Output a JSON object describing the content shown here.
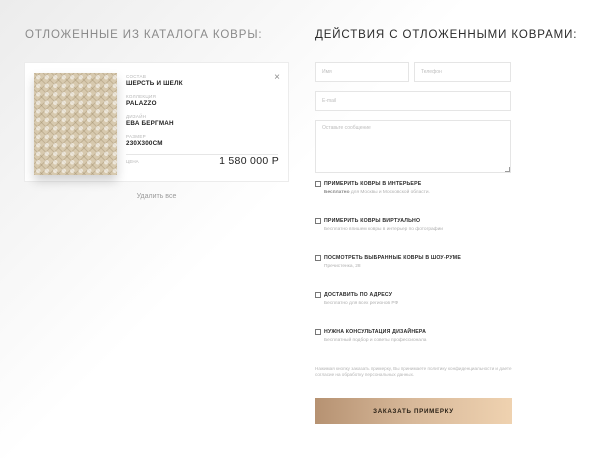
{
  "left": {
    "title": "ОТЛОЖЕННЫЕ ИЗ КАТАЛОГА КОВРЫ:",
    "delete_all": "Удалить все",
    "item": {
      "attrs": [
        {
          "label": "СОСТАВ",
          "value": "ШЕРСТЬ И ШЕЛК"
        },
        {
          "label": "КОЛЛЕКЦИЯ",
          "value": "PALAZZO"
        },
        {
          "label": "ДИЗАЙН",
          "value": "ЕВА БЕРГМАН"
        },
        {
          "label": "РАЗМЕР",
          "value": "230X300СМ"
        }
      ],
      "price_label": "ЦЕНА",
      "price": "1 580 000 Р",
      "close_icon": "×"
    }
  },
  "right": {
    "title": "ДЕЙСТВИЯ С ОТЛОЖЕННЫМИ КОВРАМИ:",
    "form": {
      "name_placeholder": "Имя",
      "phone_placeholder": "Телефон",
      "email_placeholder": "E-mail",
      "message_placeholder": "Оставьте сообщение"
    },
    "options": [
      {
        "title": "ПРИМЕРИТЬ КОВРЫ В ИНТЕРЬЕРЕ",
        "desc_bold": "Бесплатно",
        "desc": " для Москвы и Московской области."
      },
      {
        "title": "ПРИМЕРИТЬ КОВРЫ ВИРТУАЛЬНО",
        "desc_bold": "",
        "desc": "Бесплатно впишем ковры в интерьер по фотографии"
      },
      {
        "title": "ПОСМОТРЕТЬ ВЫБРАННЫЕ КОВРЫ В ШОУ-РУМЕ",
        "desc_bold": "",
        "desc": "Пречистенка, 28"
      },
      {
        "title": "ДОСТАВИТЬ ПО АДРЕСУ",
        "desc_bold": "",
        "desc": "Бесплатно для всех регионов РФ"
      },
      {
        "title": "НУЖНА КОНСУЛЬТАЦИЯ ДИЗАЙНЕРА",
        "desc_bold": "",
        "desc": "Бесплатный подбор и советы профессионала"
      }
    ],
    "consent": "Нажимая кнопку заказать примерку, Вы принимаете политику конфиденциальности и даете согласие на обработку персональных данных.",
    "submit_label": "ЗАКАЗАТЬ ПРИМЕРКУ"
  },
  "colors": {
    "gold_start": "#b69272",
    "gold_end": "#efd2b0",
    "rug_base": "#d7c9ae"
  }
}
